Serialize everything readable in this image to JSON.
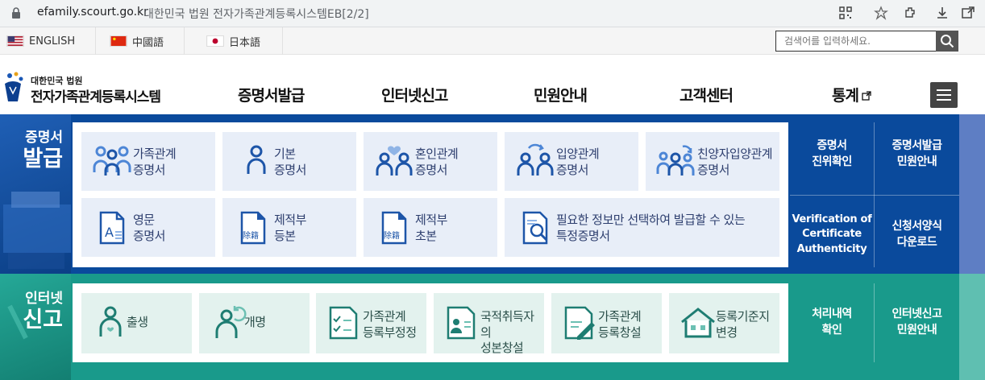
{
  "browser": {
    "url": "efamily.scourt.go.kr",
    "title": "대한민국 법원 전자가족관계등록시스템EB[2/2]"
  },
  "languages": [
    {
      "label": "ENGLISH",
      "flag": "us"
    },
    {
      "label": "中國語",
      "flag": "cn"
    },
    {
      "label": "日本語",
      "flag": "jp"
    }
  ],
  "search": {
    "placeholder": "검색어를 입력하세요."
  },
  "logo": {
    "sub": "대한민국 법원",
    "main": "전자가족관계등록시스템"
  },
  "gnb": [
    "증명서발급",
    "인터넷신고",
    "민원안내",
    "고객센터",
    "통계"
  ],
  "colors": {
    "blue_band": "#0a4a9c",
    "teal_band": "#199a8b",
    "tile_blue": "#e8eef8",
    "tile_teal": "#e3f2ee"
  },
  "certificate": {
    "title_a": "증명서",
    "title_b": "발급",
    "tiles": [
      {
        "line1": "가족관계",
        "line2": "증명서",
        "icon": "family-icon"
      },
      {
        "line1": "기본",
        "line2": "증명서",
        "icon": "person-icon"
      },
      {
        "line1": "혼인관계",
        "line2": "증명서",
        "icon": "couple-heart-icon"
      },
      {
        "line1": "입양관계",
        "line2": "증명서",
        "icon": "adoption-icon"
      },
      {
        "line1": "친양자입양관계",
        "line2": "증명서",
        "icon": "adoption-family-icon"
      },
      {
        "line1": "영문",
        "line2": "증명서",
        "icon": "english-document-icon"
      },
      {
        "line1": "제적부",
        "line2": "등본",
        "icon": "register-document-icon",
        "badge": "除籍"
      },
      {
        "line1": "제적부",
        "line2": "초본",
        "icon": "register-document-icon",
        "badge": "除籍"
      },
      {
        "line1": "필요한 정보만 선택하여 발급할 수 있는",
        "line2": "특정증명서",
        "icon": "document-search-icon"
      }
    ],
    "side_links": [
      {
        "line1": "증명서",
        "line2": "진위확인"
      },
      {
        "line1": "증명서발급",
        "line2": "민원안내"
      },
      {
        "line1": "Verification of",
        "line2": "Certificate",
        "line3": "Authenticity"
      },
      {
        "line1": "신청서양식",
        "line2": "다운로드"
      }
    ]
  },
  "report": {
    "title_a": "인터넷",
    "title_b": "신고",
    "tiles": [
      {
        "line1": "출생",
        "line2": "",
        "icon": "birth-icon"
      },
      {
        "line1": "개명",
        "line2": "",
        "icon": "rename-icon"
      },
      {
        "line1": "가족관계",
        "line2": "등록부정정",
        "icon": "checklist-document-icon"
      },
      {
        "line1": "국적취득자의",
        "line2": "성본창설",
        "icon": "id-card-icon"
      },
      {
        "line1": "가족관계",
        "line2": "등록창설",
        "icon": "pen-document-icon"
      },
      {
        "line1": "등록기준지",
        "line2": "변경",
        "icon": "house-icon"
      }
    ],
    "side_links": [
      {
        "line1": "처리내역",
        "line2": "확인"
      },
      {
        "line1": "인터넷신고",
        "line2": "민원안내"
      }
    ]
  }
}
